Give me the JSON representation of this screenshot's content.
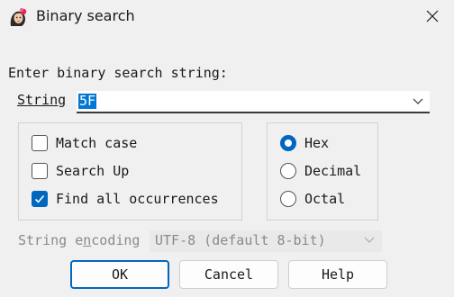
{
  "window": {
    "title": "Binary search",
    "app_icon": "character-icon",
    "close_icon": "close-icon"
  },
  "prompt": "Enter binary search string:",
  "string_field": {
    "label": "String",
    "value": "5F"
  },
  "options": {
    "match_case": {
      "label": "Match case",
      "checked": false
    },
    "search_up": {
      "label": "Search Up",
      "checked": false
    },
    "find_all": {
      "label": "Find all occurrences",
      "checked": true
    }
  },
  "radix": {
    "hex": {
      "label": "Hex",
      "selected": true
    },
    "decimal": {
      "label": "Decimal",
      "selected": false
    },
    "octal": {
      "label": "Octal",
      "selected": false
    }
  },
  "encoding": {
    "label": "String encoding",
    "value": "UTF-8 (default 8-bit)",
    "disabled": true
  },
  "buttons": {
    "ok": "OK",
    "cancel": "Cancel",
    "help": "Help"
  },
  "colors": {
    "accent": "#0067c0",
    "selection": "#0078d4",
    "background": "#f0f0f0",
    "disabled_text": "#8a8a8a"
  }
}
